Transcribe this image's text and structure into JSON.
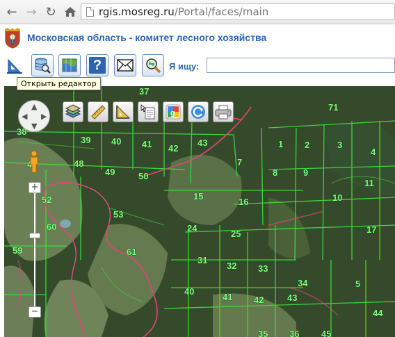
{
  "browser": {
    "url_domain": "rgis.mosreg.ru",
    "url_path": "/Portal/faces/main",
    "icons": [
      "back-icon",
      "forward-icon",
      "reload-icon",
      "home-icon",
      "page-icon"
    ]
  },
  "header": {
    "title": "Московская область - комитет лесного хозяйства",
    "emblem_icon": "coat-of-arms-icon"
  },
  "toolbar": {
    "buttons": [
      {
        "name": "editor-button",
        "icon": "ruler-triangle-icon",
        "active": true
      },
      {
        "name": "database-search-button",
        "icon": "database-search-icon"
      },
      {
        "name": "map-layers-button",
        "icon": "map-layers-icon"
      },
      {
        "name": "help-button",
        "icon": "question-icon",
        "label": "?"
      },
      {
        "name": "mail-button",
        "icon": "envelope-icon"
      },
      {
        "name": "zoom-search-button",
        "icon": "magnifier-icon"
      }
    ],
    "search_label": "Я ищу:",
    "search_value": "",
    "tooltip": "Открыть редактор"
  },
  "map_tools": [
    {
      "name": "layers-tool-button",
      "icon": "layers-stack-icon"
    },
    {
      "name": "ruler-tool-button",
      "icon": "ruler-icon"
    },
    {
      "name": "area-tool-button",
      "icon": "area-measure-icon"
    },
    {
      "name": "info-tool-button",
      "icon": "pointer-info-icon"
    },
    {
      "name": "google-tool-button",
      "icon": "google-icon"
    },
    {
      "name": "refresh-tool-button",
      "icon": "refresh-icon"
    },
    {
      "name": "print-tool-button",
      "icon": "printer-icon"
    }
  ],
  "map_controls": {
    "pan": "pan-control-icon",
    "streetview": "pegman-icon",
    "zoom_in": "+",
    "zoom_out": "−"
  },
  "colors": {
    "title_blue": "#2b67b5",
    "grid_line": "#3ddc3d",
    "label_green": "#7dff7d",
    "boundary_pink": "#e0457a"
  },
  "map_labels": [
    "37",
    "71",
    "38",
    "39",
    "40",
    "41",
    "42",
    "43",
    "1",
    "2",
    "3",
    "4",
    "47",
    "48",
    "49",
    "50",
    "7",
    "8",
    "9",
    "11",
    "52",
    "15",
    "16",
    "10",
    "53",
    "60",
    "24",
    "25",
    "17",
    "59",
    "61",
    "31",
    "32",
    "33",
    "34",
    "40",
    "41",
    "42",
    "43",
    "5",
    "44",
    "35",
    "36",
    "45"
  ]
}
